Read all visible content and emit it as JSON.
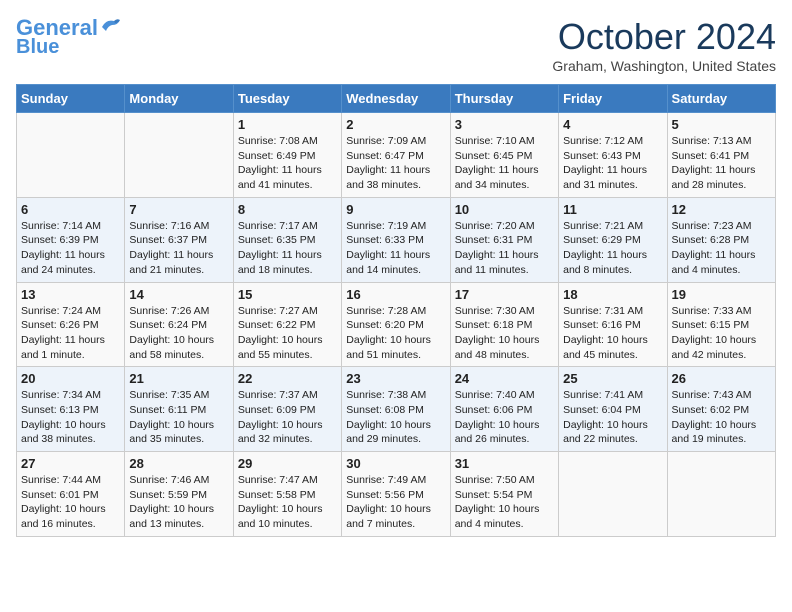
{
  "header": {
    "logo_line1": "General",
    "logo_line2": "Blue",
    "month_title": "October 2024",
    "location": "Graham, Washington, United States"
  },
  "weekdays": [
    "Sunday",
    "Monday",
    "Tuesday",
    "Wednesday",
    "Thursday",
    "Friday",
    "Saturday"
  ],
  "weeks": [
    [
      {
        "day": "",
        "info": ""
      },
      {
        "day": "",
        "info": ""
      },
      {
        "day": "1",
        "info": "Sunrise: 7:08 AM\nSunset: 6:49 PM\nDaylight: 11 hours and 41 minutes."
      },
      {
        "day": "2",
        "info": "Sunrise: 7:09 AM\nSunset: 6:47 PM\nDaylight: 11 hours and 38 minutes."
      },
      {
        "day": "3",
        "info": "Sunrise: 7:10 AM\nSunset: 6:45 PM\nDaylight: 11 hours and 34 minutes."
      },
      {
        "day": "4",
        "info": "Sunrise: 7:12 AM\nSunset: 6:43 PM\nDaylight: 11 hours and 31 minutes."
      },
      {
        "day": "5",
        "info": "Sunrise: 7:13 AM\nSunset: 6:41 PM\nDaylight: 11 hours and 28 minutes."
      }
    ],
    [
      {
        "day": "6",
        "info": "Sunrise: 7:14 AM\nSunset: 6:39 PM\nDaylight: 11 hours and 24 minutes."
      },
      {
        "day": "7",
        "info": "Sunrise: 7:16 AM\nSunset: 6:37 PM\nDaylight: 11 hours and 21 minutes."
      },
      {
        "day": "8",
        "info": "Sunrise: 7:17 AM\nSunset: 6:35 PM\nDaylight: 11 hours and 18 minutes."
      },
      {
        "day": "9",
        "info": "Sunrise: 7:19 AM\nSunset: 6:33 PM\nDaylight: 11 hours and 14 minutes."
      },
      {
        "day": "10",
        "info": "Sunrise: 7:20 AM\nSunset: 6:31 PM\nDaylight: 11 hours and 11 minutes."
      },
      {
        "day": "11",
        "info": "Sunrise: 7:21 AM\nSunset: 6:29 PM\nDaylight: 11 hours and 8 minutes."
      },
      {
        "day": "12",
        "info": "Sunrise: 7:23 AM\nSunset: 6:28 PM\nDaylight: 11 hours and 4 minutes."
      }
    ],
    [
      {
        "day": "13",
        "info": "Sunrise: 7:24 AM\nSunset: 6:26 PM\nDaylight: 11 hours and 1 minute."
      },
      {
        "day": "14",
        "info": "Sunrise: 7:26 AM\nSunset: 6:24 PM\nDaylight: 10 hours and 58 minutes."
      },
      {
        "day": "15",
        "info": "Sunrise: 7:27 AM\nSunset: 6:22 PM\nDaylight: 10 hours and 55 minutes."
      },
      {
        "day": "16",
        "info": "Sunrise: 7:28 AM\nSunset: 6:20 PM\nDaylight: 10 hours and 51 minutes."
      },
      {
        "day": "17",
        "info": "Sunrise: 7:30 AM\nSunset: 6:18 PM\nDaylight: 10 hours and 48 minutes."
      },
      {
        "day": "18",
        "info": "Sunrise: 7:31 AM\nSunset: 6:16 PM\nDaylight: 10 hours and 45 minutes."
      },
      {
        "day": "19",
        "info": "Sunrise: 7:33 AM\nSunset: 6:15 PM\nDaylight: 10 hours and 42 minutes."
      }
    ],
    [
      {
        "day": "20",
        "info": "Sunrise: 7:34 AM\nSunset: 6:13 PM\nDaylight: 10 hours and 38 minutes."
      },
      {
        "day": "21",
        "info": "Sunrise: 7:35 AM\nSunset: 6:11 PM\nDaylight: 10 hours and 35 minutes."
      },
      {
        "day": "22",
        "info": "Sunrise: 7:37 AM\nSunset: 6:09 PM\nDaylight: 10 hours and 32 minutes."
      },
      {
        "day": "23",
        "info": "Sunrise: 7:38 AM\nSunset: 6:08 PM\nDaylight: 10 hours and 29 minutes."
      },
      {
        "day": "24",
        "info": "Sunrise: 7:40 AM\nSunset: 6:06 PM\nDaylight: 10 hours and 26 minutes."
      },
      {
        "day": "25",
        "info": "Sunrise: 7:41 AM\nSunset: 6:04 PM\nDaylight: 10 hours and 22 minutes."
      },
      {
        "day": "26",
        "info": "Sunrise: 7:43 AM\nSunset: 6:02 PM\nDaylight: 10 hours and 19 minutes."
      }
    ],
    [
      {
        "day": "27",
        "info": "Sunrise: 7:44 AM\nSunset: 6:01 PM\nDaylight: 10 hours and 16 minutes."
      },
      {
        "day": "28",
        "info": "Sunrise: 7:46 AM\nSunset: 5:59 PM\nDaylight: 10 hours and 13 minutes."
      },
      {
        "day": "29",
        "info": "Sunrise: 7:47 AM\nSunset: 5:58 PM\nDaylight: 10 hours and 10 minutes."
      },
      {
        "day": "30",
        "info": "Sunrise: 7:49 AM\nSunset: 5:56 PM\nDaylight: 10 hours and 7 minutes."
      },
      {
        "day": "31",
        "info": "Sunrise: 7:50 AM\nSunset: 5:54 PM\nDaylight: 10 hours and 4 minutes."
      },
      {
        "day": "",
        "info": ""
      },
      {
        "day": "",
        "info": ""
      }
    ]
  ]
}
